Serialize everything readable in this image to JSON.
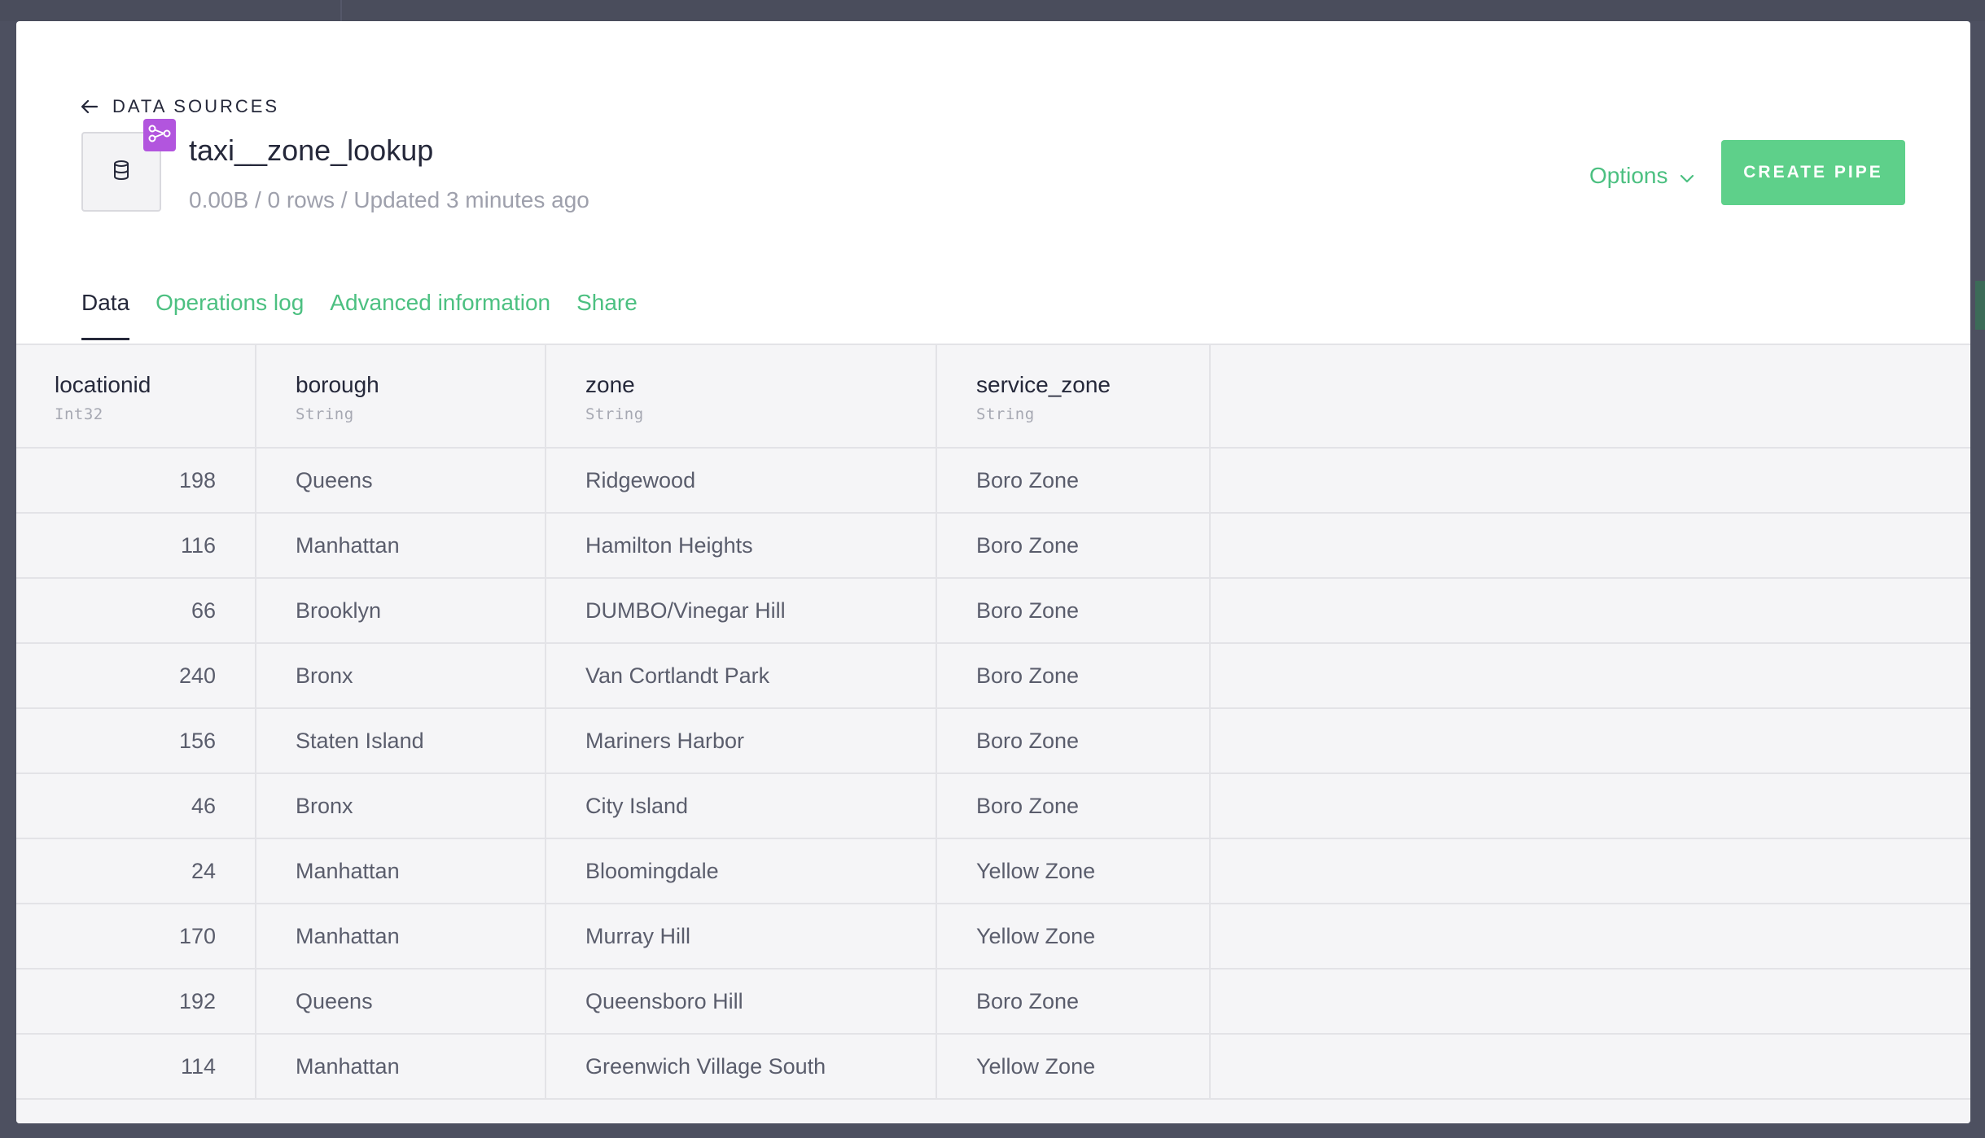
{
  "header": {
    "back_label": "DATA SOURCES",
    "title": "taxi__zone_lookup",
    "meta": "0.00B / 0 rows / Updated 3 minutes ago",
    "options_label": "Options",
    "create_pipe_label": "CREATE PIPE"
  },
  "tabs": [
    {
      "label": "Data",
      "active": true
    },
    {
      "label": "Operations log",
      "active": false
    },
    {
      "label": "Advanced information",
      "active": false
    },
    {
      "label": "Share",
      "active": false
    }
  ],
  "table": {
    "columns": [
      {
        "name": "locationid",
        "type": "Int32"
      },
      {
        "name": "borough",
        "type": "String"
      },
      {
        "name": "zone",
        "type": "String"
      },
      {
        "name": "service_zone",
        "type": "String"
      }
    ],
    "rows": [
      [
        "198",
        "Queens",
        "Ridgewood",
        "Boro Zone"
      ],
      [
        "116",
        "Manhattan",
        "Hamilton Heights",
        "Boro Zone"
      ],
      [
        "66",
        "Brooklyn",
        "DUMBO/Vinegar Hill",
        "Boro Zone"
      ],
      [
        "240",
        "Bronx",
        "Van Cortlandt Park",
        "Boro Zone"
      ],
      [
        "156",
        "Staten Island",
        "Mariners Harbor",
        "Boro Zone"
      ],
      [
        "46",
        "Bronx",
        "City Island",
        "Boro Zone"
      ],
      [
        "24",
        "Manhattan",
        "Bloomingdale",
        "Yellow Zone"
      ],
      [
        "170",
        "Manhattan",
        "Murray Hill",
        "Yellow Zone"
      ],
      [
        "192",
        "Queens",
        "Queensboro Hill",
        "Boro Zone"
      ],
      [
        "114",
        "Manhattan",
        "Greenwich Village South",
        "Yellow Zone"
      ]
    ]
  },
  "colors": {
    "accent": "#4cc081",
    "button": "#5ed08a",
    "badge": "#b255de",
    "text": "#25283a",
    "muted": "#9ea0ac",
    "overlay": "#4d5060"
  },
  "icons": {
    "back": "arrow-left-icon",
    "datasource": "database-icon",
    "badge": "share-node-icon",
    "options": "chevron-down-icon"
  }
}
